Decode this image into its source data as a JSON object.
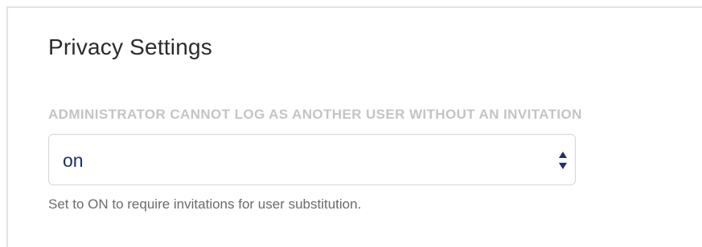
{
  "section": {
    "title": "Privacy Settings"
  },
  "setting": {
    "label": "ADMINISTRATOR CANNOT LOG AS ANOTHER USER WITHOUT AN INVITATION",
    "selected_value": "on",
    "help_text": "Set to ON to require invitations for user substitution."
  },
  "colors": {
    "label": "#c4c4c4",
    "value_text": "#1e3064",
    "arrow": "#1e3064"
  },
  "icons": {
    "select_arrows": "up-down-chevron-icon"
  }
}
